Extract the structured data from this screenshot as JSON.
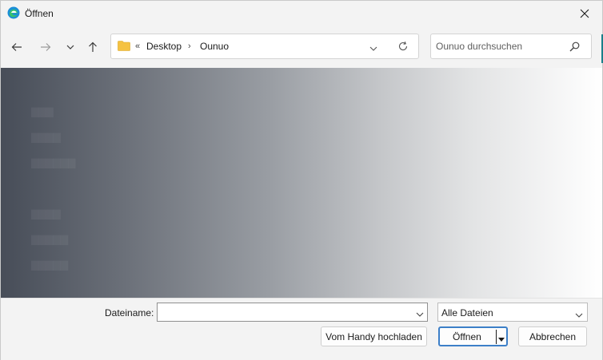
{
  "window": {
    "title": "Öffnen",
    "app_icon": "edge-icon"
  },
  "toolbar": {
    "back_icon": "arrow-left-icon",
    "forward_icon": "arrow-right-icon",
    "recent_icon": "chevron-down-icon",
    "up_icon": "arrow-up-icon",
    "breadcrumb": {
      "overflow": "«",
      "items": [
        "Desktop",
        "Ounuo"
      ],
      "separator": "›"
    },
    "search_placeholder": "Ounuo durchsuchen"
  },
  "footer": {
    "filename_label": "Dateiname:",
    "filename_value": "",
    "filetype_selected": "Alle Dateien",
    "upload_button": "Vom Handy hochladen",
    "open_button": "Öffnen",
    "cancel_button": "Abbrechen"
  },
  "colors": {
    "accent": "#3c7fc8",
    "teal": "#1a7f8a",
    "folder": "#f5c242"
  }
}
